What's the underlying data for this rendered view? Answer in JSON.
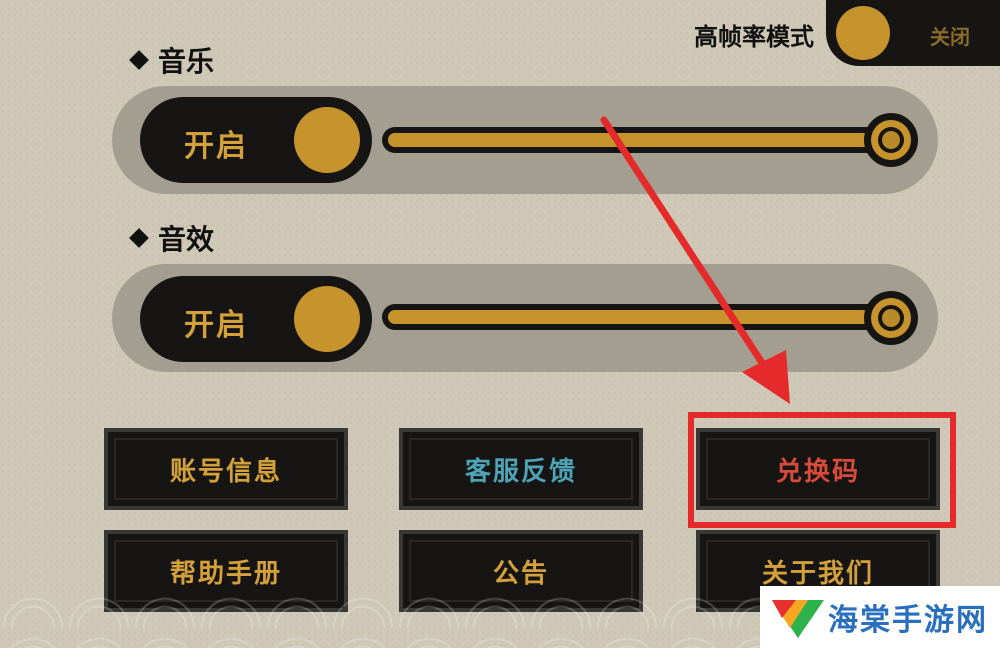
{
  "high_frame_rate": {
    "label": "高帧率模式",
    "state": "关闭",
    "on": false
  },
  "music": {
    "label": "音乐",
    "toggle_label": "开启",
    "volume": 1.0
  },
  "sound_effects": {
    "label": "音效",
    "toggle_label": "开启",
    "volume": 1.0
  },
  "menu": {
    "account_info": "账号信息",
    "customer_service": "客服反馈",
    "redeem_code": "兑换码",
    "help_manual": "帮助手册",
    "announcement": "公告",
    "about_us": "关于我们"
  },
  "watermark": {
    "text": "海棠手游网"
  },
  "colors": {
    "gold": "#c6932c",
    "dark": "#161513",
    "highlight": "#e42a2a"
  }
}
